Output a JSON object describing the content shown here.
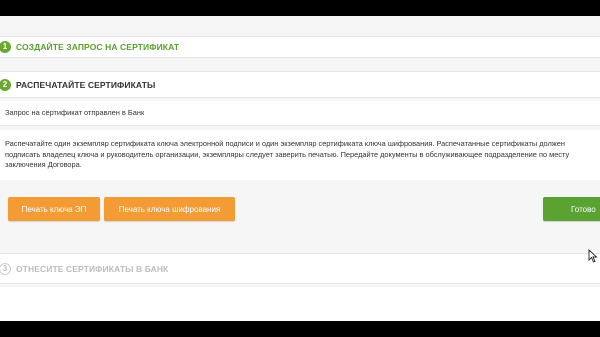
{
  "steps": [
    {
      "number": "1",
      "title": "СОЗДАЙТЕ ЗАПРОС НА СЕРТИФИКАТ"
    },
    {
      "number": "2",
      "title": "РАСПЕЧАТАЙТЕ СЕРТИФИКАТЫ"
    },
    {
      "number": "3",
      "title": "ОТНЕСИТЕ СЕРТИФИКАТЫ В БАНК"
    }
  ],
  "status_text": "Запрос на сертификат отправлен в Банк",
  "instructions": "Распечатайте один экземпляр сертификата ключа электронной подписи и один экземпляр сертификата ключа шифрования. Распечатанные сертификаты должен подписать владелец ключа и руководитель организации, экземпляры следует заверить печатью. Передайте документы в обслуживающее подразделение по месту заключения Договора.",
  "buttons": {
    "print_signature_key": "Печать ключа ЭП",
    "print_encryption_key": "Печать ключа шифрования",
    "done": "Готово"
  },
  "colors": {
    "green": "#5aa232",
    "orange": "#f39b35",
    "pending_gray": "#bdbdbd"
  }
}
